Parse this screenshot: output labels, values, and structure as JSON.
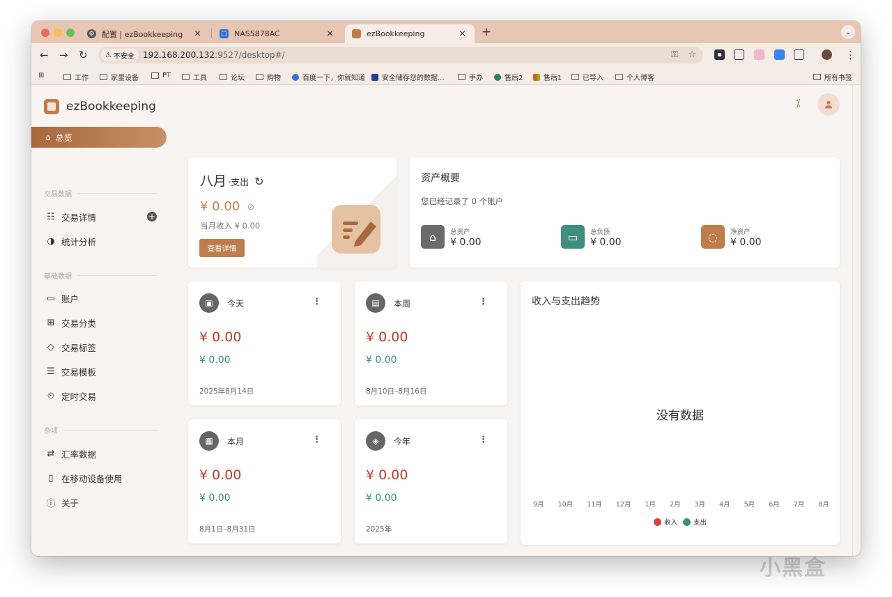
{
  "browser": {
    "tabs": [
      {
        "title": "配置 | ezBookkeeping"
      },
      {
        "title": "NAS5878AC"
      },
      {
        "title": "ezBookkeeping"
      }
    ],
    "new_tab": "+",
    "close": "×",
    "security_label": "不安全",
    "url_host": "192.168.200.132",
    "url_rest": ":9527/desktop#/",
    "bookmarks": [
      "工作",
      "家里设备",
      "PT",
      "工具",
      "论坛",
      "购物",
      "百度一下，你就知道",
      "安全储存您的数据...",
      "手办",
      "售后2",
      "售后1",
      "已导入",
      "个人博客"
    ],
    "all_bookmarks": "所有书签"
  },
  "app": {
    "name": "ezBookkeeping",
    "nav": {
      "overview": "总览",
      "section_transactions": "交易数据",
      "transaction_details": "交易详情",
      "statistics": "统计分析",
      "section_basic": "基础数据",
      "accounts": "账户",
      "categories": "交易分类",
      "tags": "交易标签",
      "templates": "交易模板",
      "scheduled": "定时交易",
      "section_misc": "杂项",
      "exchange_rates": "汇率数据",
      "mobile": "在移动设备使用",
      "about": "关于"
    }
  },
  "month_card": {
    "month": "八月",
    "type": "·支出",
    "amount": "¥ 0.00",
    "income": "当月收入 ¥ 0.00",
    "button": "查看详情"
  },
  "assets": {
    "title": "资产概要",
    "subtitle": "您已经记录了 0 个账户",
    "items": [
      {
        "label": "总资产",
        "value": "¥ 0.00",
        "color": "#6b6b6b"
      },
      {
        "label": "总负债",
        "value": "¥ 0.00",
        "color": "#3f8f80"
      },
      {
        "label": "净资产",
        "value": "¥ 0.00",
        "color": "#c07c4a"
      }
    ]
  },
  "overview": [
    {
      "title": "今天",
      "expense": "¥ 0.00",
      "income": "¥ 0.00",
      "range": "2025年8月14日"
    },
    {
      "title": "本周",
      "expense": "¥ 0.00",
      "income": "¥ 0.00",
      "range": "8月10日–8月16日"
    },
    {
      "title": "本月",
      "expense": "¥ 0.00",
      "income": "¥ 0.00",
      "range": "8月1日–8月31日"
    },
    {
      "title": "今年",
      "expense": "¥ 0.00",
      "income": "¥ 0.00",
      "range": "2025年"
    }
  ],
  "trend": {
    "title": "收入与支出趋势",
    "no_data": "没有数据",
    "months": [
      "9月",
      "10月",
      "11月",
      "12月",
      "1月",
      "2月",
      "3月",
      "4月",
      "5月",
      "6月",
      "7月",
      "8月"
    ],
    "legend": [
      {
        "label": "收入",
        "color": "#d24545"
      },
      {
        "label": "支出",
        "color": "#3f8f80"
      }
    ]
  },
  "watermark": "小黑盒",
  "colors": {
    "accent": "#c07c4a",
    "expense": "#c0392b",
    "income": "#2e8b76"
  }
}
